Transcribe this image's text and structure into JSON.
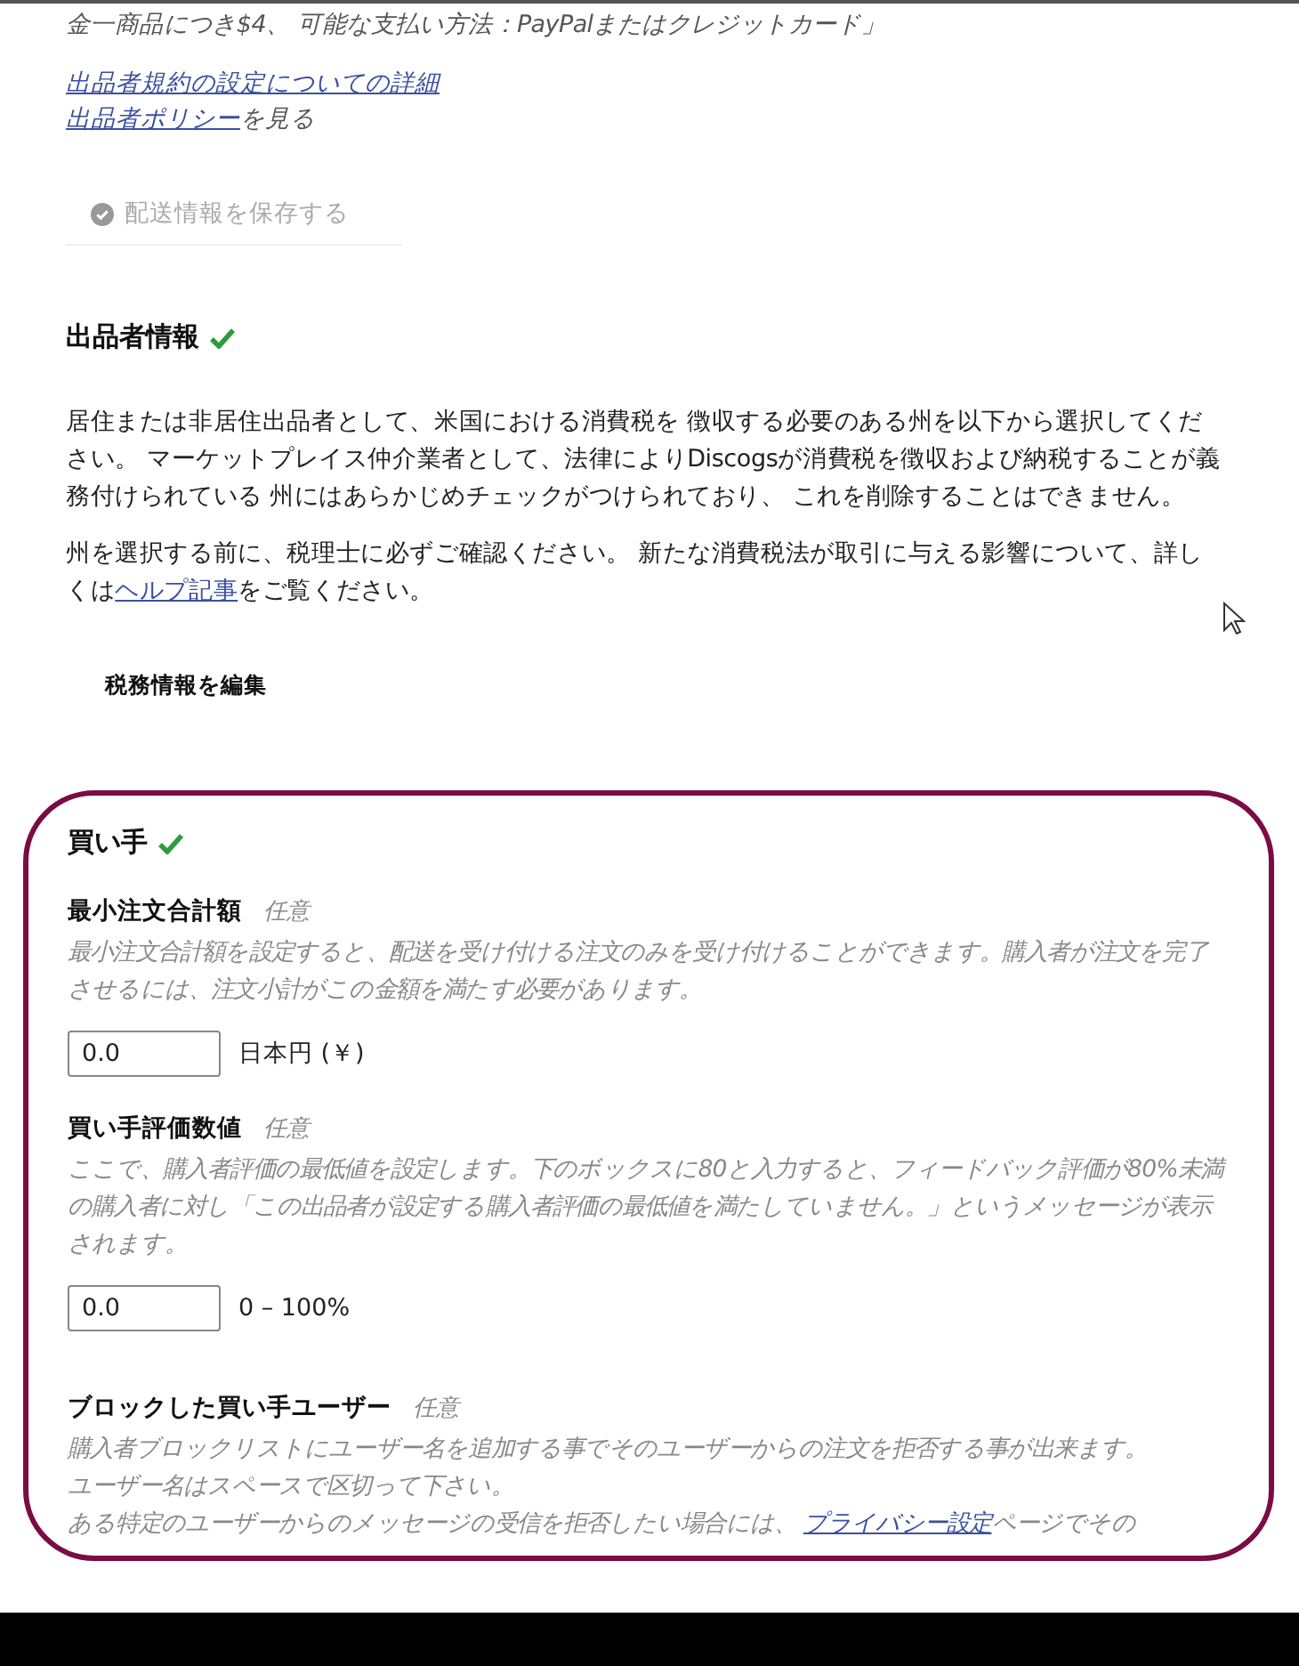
{
  "shipping_note": "金一商品につき$4、 可能な支払い方法：PayPalまたはクレジットカード」",
  "links": [
    {
      "link": "出品者規約の設定についての詳細"
    },
    {
      "link": "出品者ポリシー",
      "after": "を見る"
    }
  ],
  "save_button": {
    "label": "配送情報を保存する",
    "disabled": true
  },
  "seller_info": {
    "title": "出品者情報",
    "complete": true,
    "paragraphs": [
      {
        "before": "居住または非居住出品者として、米国における消費税を 徴収する必要のある州を以下から選択してください。 マーケットプレイス仲介業者として、法律によりDiscogsが消費税を徴収および納税することが義務付けられている 州にはあらかじめチェックがつけられており、 これを削除することはできません。"
      },
      {
        "before": "州を選択する前に、税理士に必ずご確認ください。 新たな消費税法が取引に与える影響について、詳しくは",
        "link": "ヘルプ記事",
        "after": "をご覧ください。"
      }
    ],
    "edit_button": "税務情報を編集"
  },
  "buyer": {
    "title": "買い手",
    "complete": true,
    "highlighted": true,
    "fields": [
      {
        "kind": "input",
        "label": "最小注文合計額",
        "optional": "任意",
        "help": "最小注文合計額を設定すると、配送を受け付ける注文のみを受け付けることができます。購入者が注文を完了させるには、注文小計がこの金額を満たす必要があります。",
        "value": "0.0",
        "unit": "日本円 (￥)"
      },
      {
        "kind": "input",
        "label": "買い手評価数値",
        "optional": "任意",
        "help": "ここで、購入者評価の最低値を設定します。下のボックスに80と入力すると、フィードバック評価が80%未満の購入者に対し「この出品者が設定する購入者評価の最低値を満たしていません。」というメッセージが表示されます。",
        "value": "0.0",
        "unit": "0 – 100%"
      },
      {
        "kind": "blocklist",
        "label": "ブロックした買い手ユーザー",
        "optional": "任意",
        "help_lines": [
          "購入者ブロックリストにユーザー名を追加する事でそのユーザーからの注文を拒否する事が出来ます。",
          "ユーザー名はスペースで区切って下さい。"
        ],
        "note": {
          "before": "ある特定のユーザーからのメッセージの受信を拒否したい場合には、 ",
          "link": "プライバシー設定",
          "after": "ページでその"
        }
      }
    ]
  }
}
